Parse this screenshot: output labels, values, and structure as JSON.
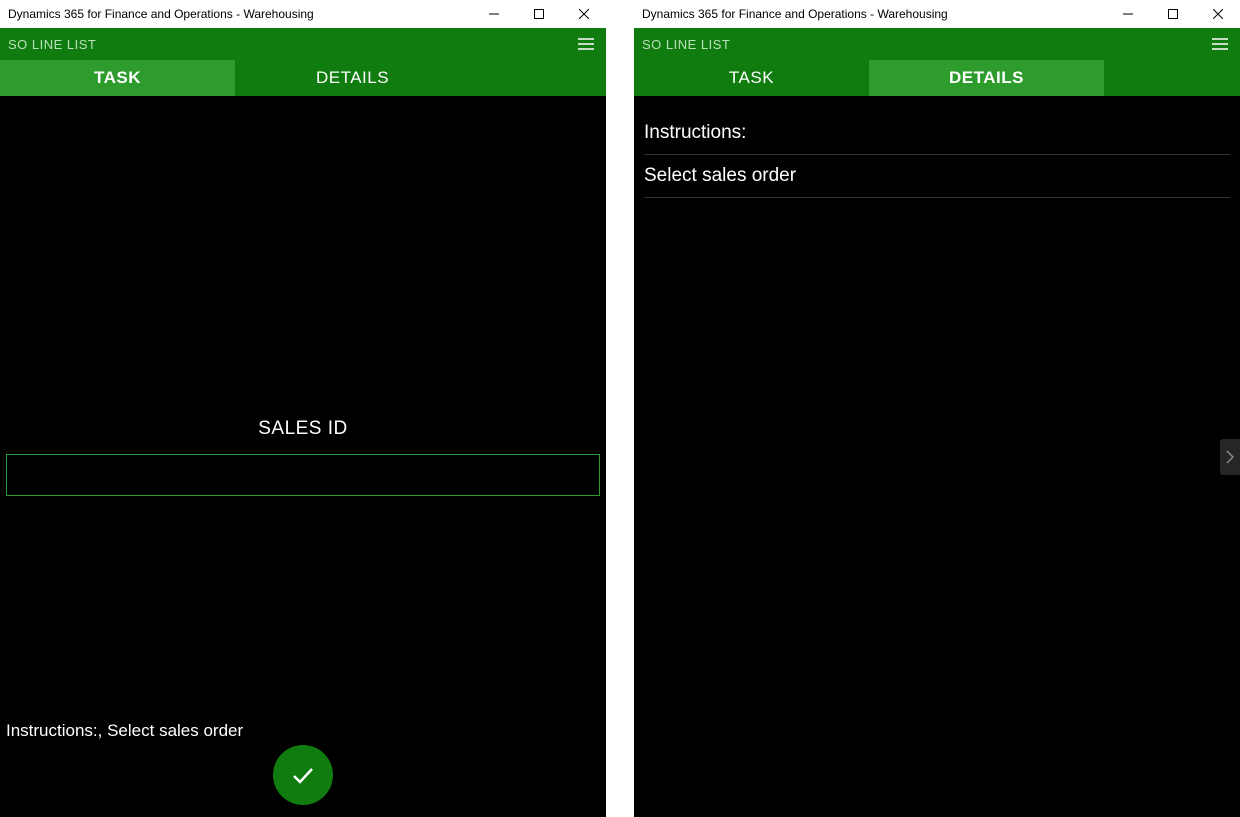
{
  "windows": [
    {
      "title": "Dynamics 365 for Finance and Operations - Warehousing",
      "header": {
        "screen_title": "SO LINE LIST",
        "tabs": {
          "task": "TASK",
          "details": "DETAILS",
          "active": "task"
        }
      },
      "task": {
        "field_label": "SALES ID",
        "field_value": "",
        "instructions": "Instructions:, Select sales order"
      }
    },
    {
      "title": "Dynamics 365 for Finance and Operations - Warehousing",
      "header": {
        "screen_title": "SO LINE LIST",
        "tabs": {
          "task": "TASK",
          "details": "DETAILS",
          "active": "details"
        }
      },
      "details": {
        "rows": [
          "Instructions:",
          "Select sales order"
        ]
      }
    }
  ],
  "icons": {
    "hamburger": "hamburger-icon",
    "minimize": "minimize-icon",
    "maximize": "maximize-icon",
    "close": "close-icon",
    "check": "check-icon",
    "chevron_right": "chevron-right-icon"
  }
}
